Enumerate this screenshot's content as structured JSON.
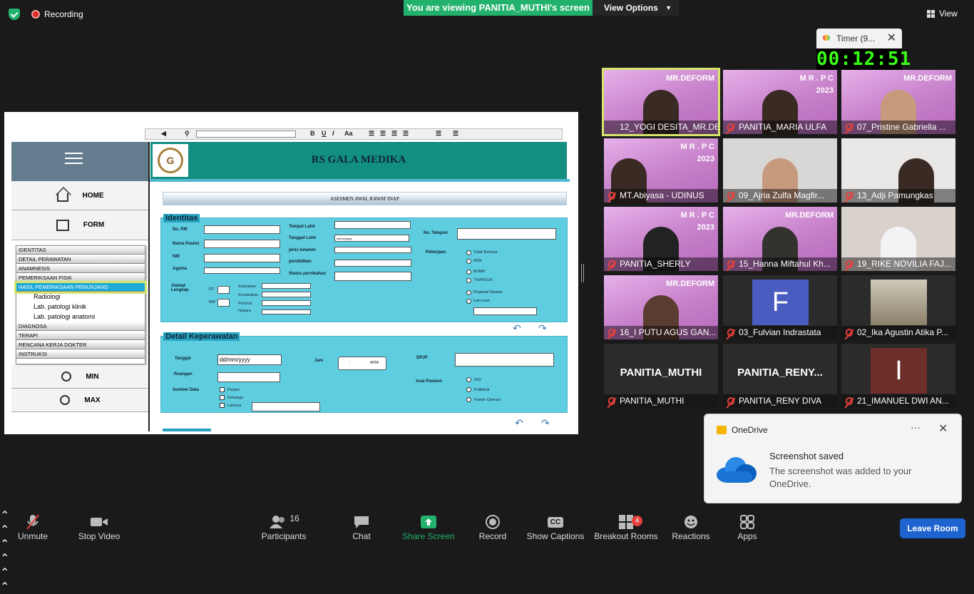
{
  "top": {
    "recording": "Recording",
    "viewing": "You are viewing PANITIA_MUTHI's screen",
    "view_options": "View Options",
    "view": "View"
  },
  "shared": {
    "hospital": "RS GALA MEDIKA",
    "form_title": "ASESMEN AWAL RAWAT INAP",
    "nav": {
      "home": "HOME",
      "form": "FORM",
      "min": "MIN",
      "max": "MAX"
    },
    "menu": [
      "IDENTITAS",
      "DETAIL PERAWATAN",
      "ANAMNESIS",
      "PEMERIKSAAN FISIK",
      "HASIL PEMERIKSAAN PENUNJANG"
    ],
    "submenu": [
      "Radiologi",
      "Lab. patologi klinik",
      "Lab. patologi anatomi"
    ],
    "menu2": [
      "DIAGNOSA",
      "TERAPI",
      "RENCANA KERJA DOKTER",
      "INSTRUKSI"
    ],
    "identitas": {
      "title": "Identitas",
      "no_rm": "No. RM",
      "nama": "Nama Pasien",
      "nik": "NIK",
      "agama": "Agama",
      "alamat": "Alamat Lengkap",
      "rt": "RT",
      "rw": "RW",
      "kelurahan": "Kelurahan",
      "kecamatan": "Kecamatan",
      "provinsi": "Provinsi",
      "negara": "Negara",
      "tempat_lahir": "Tempat Lahir",
      "tanggal_lahir": "Tanggal Lahir",
      "tanggal_lahir_value": "dd/mm/yyyy",
      "jenis_kelamin": "jenis kelamin",
      "pendidikan": "pendidikan",
      "status": "Status pernikahan",
      "no_telp": "No. Telepon",
      "pekerjaan": "Pekerjaan",
      "pekerjaan_opts": [
        "Tidak Bekerja",
        "ASN",
        "BUMN",
        "TNI/POLRI",
        "Pegawai Swasta",
        "Lain-Lain"
      ]
    },
    "detail": {
      "title": "Detail Keperawatan",
      "tanggal": "Tanggal",
      "tanggal_value": "dd/mm/yyyy",
      "jam": "Jam",
      "jam_value": ":",
      "wita": "WITA",
      "dpjp": "DPJP",
      "ruangan": "Ruangan",
      "sumber": "Sumber Data",
      "sumber_opts": [
        "Pasien",
        "Keluarga",
        "Lainnya"
      ],
      "asal": "Asal Pasieen",
      "asal_opts": [
        "IGD",
        "Poliklinik",
        "Kamar Operasi"
      ]
    }
  },
  "timer": {
    "title": "Timer (9...",
    "value": "00:12:51"
  },
  "participants": [
    {
      "name": "12_YOGI DESITA_MR.DEF...",
      "brand": "MR.DEFORM"
    },
    {
      "name": "PANITIA_MARIA ULFA",
      "brand": "M R . P C\n2023"
    },
    {
      "name": "07_Pristine Gabriella ...",
      "brand": "MR.DEFORM"
    },
    {
      "name": "MT.Abiyasa - UDINUS",
      "brand": "M R . P C\n2023"
    },
    {
      "name": "09_Ajria Zulfa Magfir...",
      "brand": ""
    },
    {
      "name": "13_Adji Pamungkas",
      "brand": ""
    },
    {
      "name": "PANITIA_SHERLY",
      "brand": "M R . P C\n2023"
    },
    {
      "name": "15_Hanna Miftahul Kh...",
      "brand": "MR.DEFORM"
    },
    {
      "name": "19_RIKE NOVILIA FAJ...",
      "brand": ""
    },
    {
      "name": "16_I PUTU AGUS GAN...",
      "brand": "MR.DEFORM"
    },
    {
      "name": "03_Fulvian Indrastata",
      "brand": "",
      "initial": "F"
    },
    {
      "name": "02_Ika Agustin Atika P...",
      "brand": ""
    },
    {
      "name": "PANITIA_MUTHI",
      "brand": "",
      "big": "PANITIA_MUTHI"
    },
    {
      "name": "PANITIA_RENY DIVA",
      "brand": "",
      "big": "PANITIA_RENY..."
    },
    {
      "name": "21_IMANUEL DWI AN...",
      "brand": "",
      "initial": "I"
    }
  ],
  "toast": {
    "app": "OneDrive",
    "title": "Screenshot saved",
    "body": "The screenshot was added to your OneDrive."
  },
  "toolbar": {
    "unmute": "Unmute",
    "stop_video": "Stop Video",
    "participants": "Participants",
    "participants_count": "16",
    "chat": "Chat",
    "share": "Share Screen",
    "record": "Record",
    "captions": "Show Captions",
    "breakout": "Breakout Rooms",
    "breakout_badge": "4",
    "reactions": "Reactions",
    "apps": "Apps",
    "leave": "Leave Room"
  },
  "colors": {
    "accent": "#23b26d",
    "leave": "#1e63d0",
    "timer": "#39ff14",
    "form_bg": "#5fcde0",
    "header": "#128f80"
  }
}
